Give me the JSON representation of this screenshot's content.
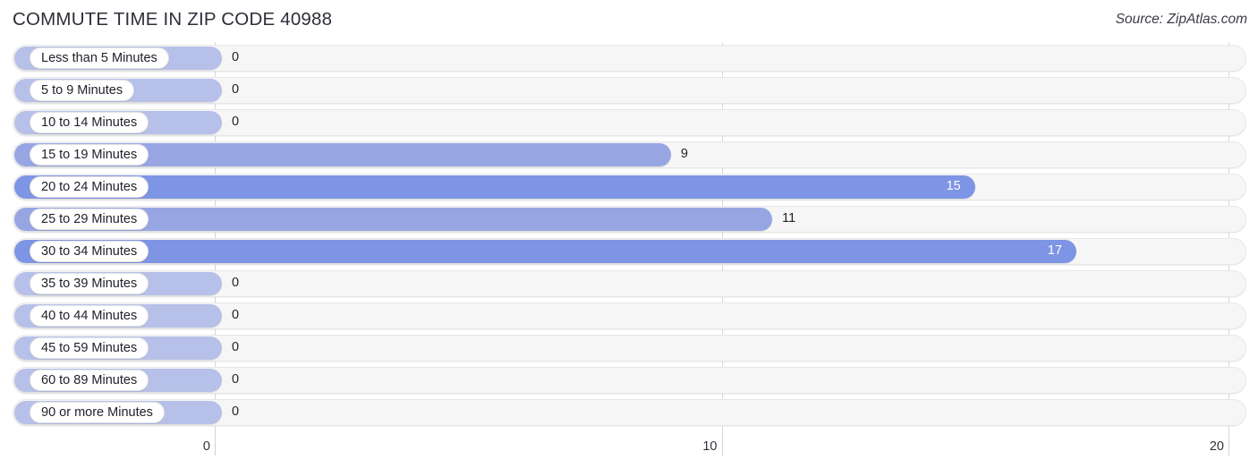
{
  "header": {
    "title": "COMMUTE TIME IN ZIP CODE 40988",
    "source": "Source: ZipAtlas.com"
  },
  "colors": {
    "bar_light": "#97a6e3",
    "bar_dark": "#7e94e4",
    "bar_zero": "#b7c0e8",
    "track": "#f6f6f6",
    "gridline": "#d8d8d8",
    "value_inside": "#ffffff",
    "value_outside": "#1f1f28"
  },
  "chart_data": {
    "type": "bar",
    "orientation": "horizontal",
    "title": "COMMUTE TIME IN ZIP CODE 40988",
    "subtitle": "",
    "xlabel": "",
    "ylabel": "",
    "xlim": [
      0,
      20
    ],
    "grid": true,
    "legend": "none",
    "xticks": [
      "0",
      "10",
      "20"
    ],
    "xtick_values": [
      0,
      10,
      20
    ],
    "categories": [
      "Less than 5 Minutes",
      "5 to 9 Minutes",
      "10 to 14 Minutes",
      "15 to 19 Minutes",
      "20 to 24 Minutes",
      "25 to 29 Minutes",
      "30 to 34 Minutes",
      "35 to 39 Minutes",
      "40 to 44 Minutes",
      "45 to 59 Minutes",
      "60 to 89 Minutes",
      "90 or more Minutes"
    ],
    "values": [
      0,
      0,
      0,
      9,
      15,
      11,
      17,
      0,
      0,
      0,
      0,
      0
    ],
    "value_labels": [
      "0",
      "0",
      "0",
      "9",
      "15",
      "11",
      "17",
      "0",
      "0",
      "0",
      "0",
      "0"
    ],
    "bar_shades": [
      "light",
      "light",
      "light",
      "light",
      "dark",
      "light",
      "dark",
      "light",
      "light",
      "light",
      "light",
      "light"
    ]
  }
}
